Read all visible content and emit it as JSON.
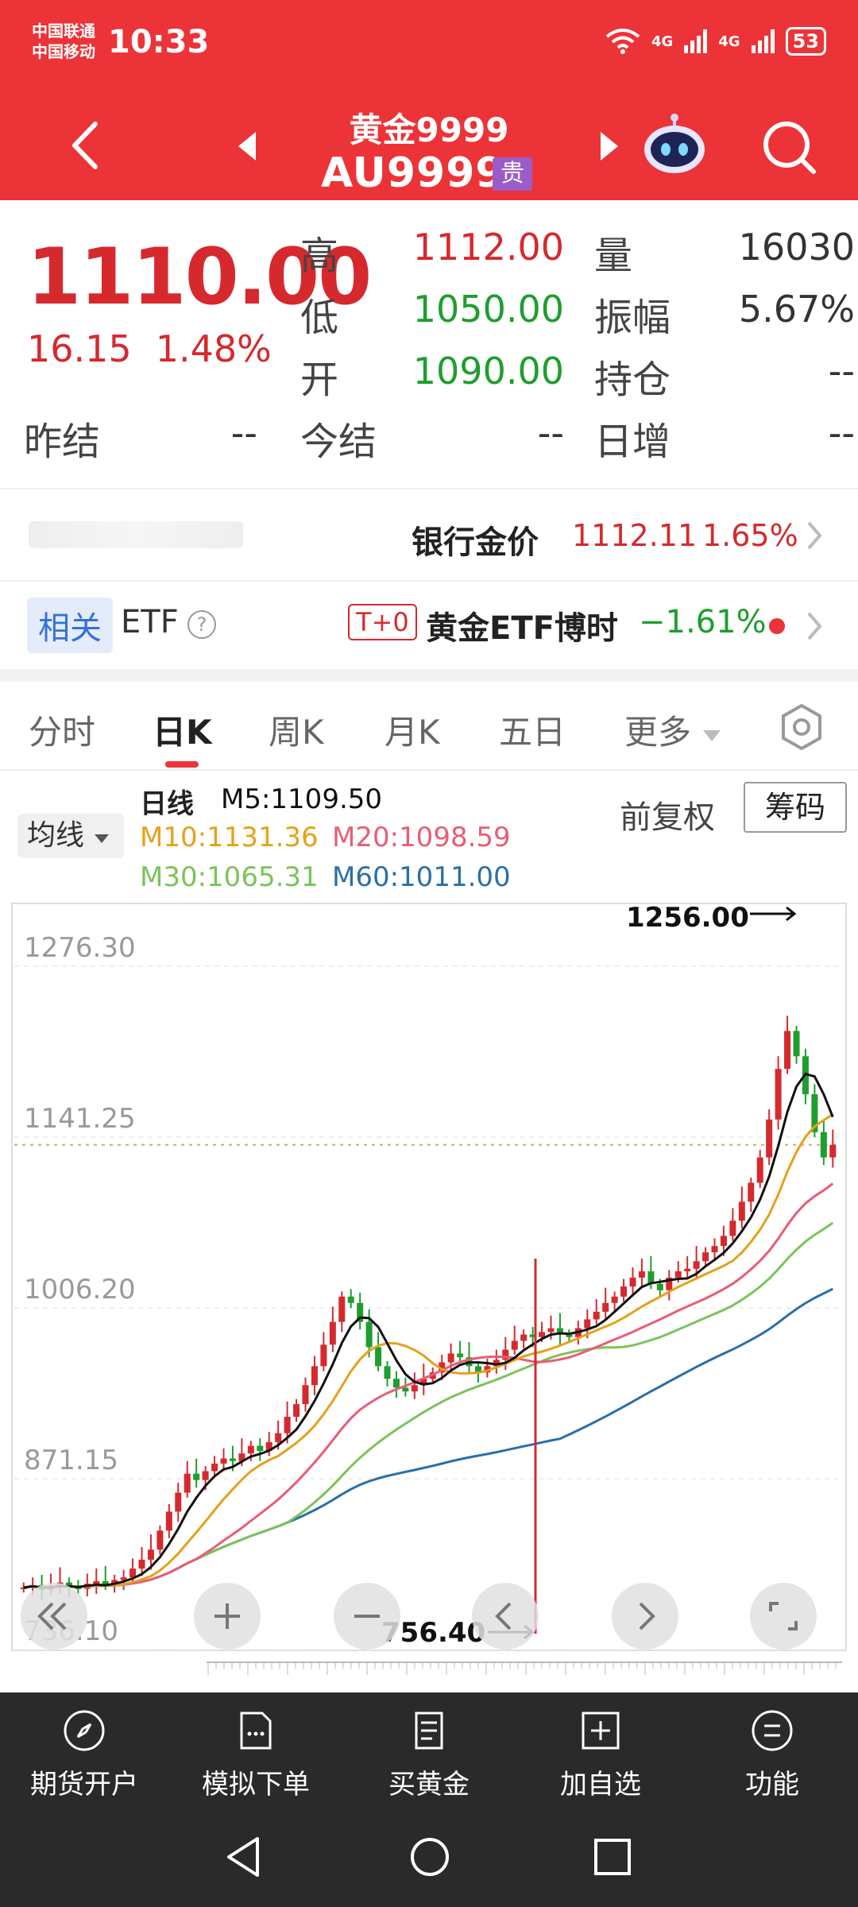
{
  "status_bar": {
    "carrier1": "中国联通",
    "carrier2": "中国移动",
    "time": "10:33",
    "net1": "4G",
    "net2": "4G",
    "battery": "53"
  },
  "nav": {
    "title": "黄金9999",
    "code": "AU9999",
    "badge": "贵"
  },
  "quote": {
    "price": "1110.00",
    "change": "16.15",
    "change_pct": "1.48%",
    "high_label": "高",
    "high": "1112.00",
    "low_label": "低",
    "low": "1050.00",
    "open_label": "开",
    "open": "1090.00",
    "volume_label": "量",
    "volume": "16030",
    "amplitude_label": "振幅",
    "amplitude": "5.67%",
    "oi_label": "持仓",
    "oi": "--",
    "prev_settle_label": "昨结",
    "prev_settle": "--",
    "settle_label": "今结",
    "settle": "--",
    "daily_inc_label": "日增",
    "daily_inc": "--"
  },
  "bank": {
    "label": "银行金价",
    "price": "1112.11",
    "pct": "1.65%"
  },
  "etf": {
    "related": "相关",
    "etf": "ETF",
    "help": "?",
    "t0": "T+0",
    "name": "黄金ETF博时",
    "pct": "−1.61%"
  },
  "tabs": [
    "分时",
    "日K",
    "周K",
    "月K",
    "五日",
    "更多"
  ],
  "indicators": {
    "ma_select": "均线",
    "period": "日线",
    "m5": "M5:1109.50",
    "m10": "M10:1131.36",
    "m20": "M20:1098.59",
    "m30": "M30:1065.31",
    "m60": "M60:1011.00",
    "adjust": "前复权",
    "chips": "筹码"
  },
  "chart_data": {
    "type": "candlestick",
    "y_ticks": [
      "1276.30",
      "1141.25",
      "1006.20",
      "871.15",
      "736.10"
    ],
    "ylim": [
      736.1,
      1276.3
    ],
    "last_price_line": 1110.0,
    "annotations": [
      {
        "text": "1256.00",
        "value": 1256.0,
        "note": "high"
      },
      {
        "text": "756.40",
        "value": 756.4,
        "note": "low"
      }
    ],
    "close_series": [
      760,
      762,
      758,
      761,
      764,
      760,
      759,
      763,
      765,
      762,
      766,
      768,
      775,
      782,
      790,
      805,
      820,
      835,
      850,
      845,
      852,
      858,
      862,
      860,
      866,
      872,
      868,
      875,
      882,
      895,
      905,
      920,
      935,
      952,
      970,
      990,
      985,
      970,
      950,
      935,
      925,
      918,
      915,
      920,
      925,
      930,
      938,
      945,
      942,
      935,
      930,
      935,
      940,
      948,
      955,
      960,
      958,
      962,
      965,
      960,
      958,
      965,
      972,
      978,
      985,
      990,
      998,
      1005,
      1010,
      1000,
      995,
      1005,
      1010,
      1012,
      1018,
      1025,
      1030,
      1038,
      1050,
      1065,
      1080,
      1100,
      1130,
      1170,
      1200,
      1180,
      1150,
      1120,
      1100,
      1110
    ],
    "ma_colors": {
      "M5": "#111111",
      "M10": "#e5a11a",
      "M20": "#ea5c75",
      "M30": "#7cc35a",
      "M60": "#2a6fa8"
    }
  },
  "colors": {
    "brand_red": "#ec3338",
    "up": "#d6292e",
    "down": "#1e9e2e"
  },
  "bottom_tabs": [
    "期货开户",
    "模拟下单",
    "买黄金",
    "加自选",
    "功能"
  ]
}
